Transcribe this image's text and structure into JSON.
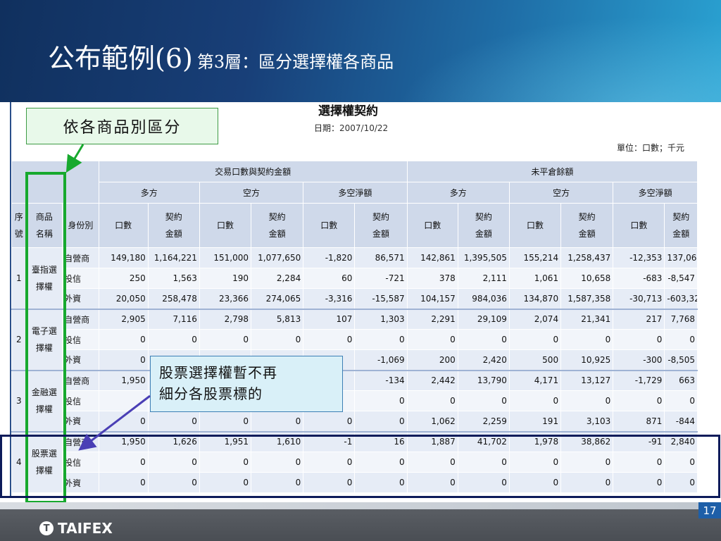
{
  "slide": {
    "title_main": "公布範例(6)",
    "title_sub": "第3層：區分選擇權各商品",
    "page_number": "17"
  },
  "report": {
    "title": "選擇權契約",
    "date_label": "日期：",
    "date_value": "2007/10/22",
    "unit": "單位：口數；千元"
  },
  "table": {
    "header_groups": {
      "traded": "交易口數與契約金額",
      "open_interest": "未平倉餘額"
    },
    "subgroups": {
      "long": "多方",
      "short": "空方",
      "net": "多空淨額"
    },
    "col_seq": [
      "序",
      "號"
    ],
    "col_name": [
      "商品",
      "名稱"
    ],
    "col_identity": "身份別",
    "col_lots": "口數",
    "col_amount": [
      "契約",
      "金額"
    ],
    "groups": [
      {
        "seq": "1",
        "name": [
          "臺指選",
          "擇權"
        ],
        "rows": [
          {
            "identity": "自營商",
            "values": [
              "149,180",
              "1,164,221",
              "151,000",
              "1,077,650",
              "-1,820",
              "86,571",
              "142,861",
              "1,395,505",
              "155,214",
              "1,258,437",
              "-12,353",
              "137,068"
            ]
          },
          {
            "identity": "投信",
            "values": [
              "250",
              "1,563",
              "190",
              "2,284",
              "60",
              "-721",
              "378",
              "2,111",
              "1,061",
              "10,658",
              "-683",
              "-8,547"
            ]
          },
          {
            "identity": "外資",
            "values": [
              "20,050",
              "258,478",
              "23,366",
              "274,065",
              "-3,316",
              "-15,587",
              "104,157",
              "984,036",
              "134,870",
              "1,587,358",
              "-30,713",
              "-603,322"
            ]
          }
        ]
      },
      {
        "seq": "2",
        "name": [
          "電子選",
          "擇權"
        ],
        "rows": [
          {
            "identity": "自營商",
            "values": [
              "2,905",
              "7,116",
              "2,798",
              "5,813",
              "107",
              "1,303",
              "2,291",
              "29,109",
              "2,074",
              "21,341",
              "217",
              "7,768"
            ]
          },
          {
            "identity": "投信",
            "values": [
              "0",
              "0",
              "0",
              "0",
              "0",
              "0",
              "0",
              "0",
              "0",
              "0",
              "0",
              "0"
            ]
          },
          {
            "identity": "外資",
            "values": [
              "0",
              "",
              "",
              "",
              "",
              "-1,069",
              "200",
              "2,420",
              "500",
              "10,925",
              "-300",
              "-8,505"
            ]
          }
        ]
      },
      {
        "seq": "3",
        "name": [
          "金融選",
          "擇權"
        ],
        "rows": [
          {
            "identity": "自營商",
            "values": [
              "1,950",
              "",
              "",
              "",
              "",
              "-134",
              "2,442",
              "13,790",
              "4,171",
              "13,127",
              "-1,729",
              "663"
            ]
          },
          {
            "identity": "投信",
            "values": [
              "",
              "",
              "",
              "",
              "",
              "0",
              "0",
              "0",
              "0",
              "0",
              "0",
              "0"
            ]
          },
          {
            "identity": "外資",
            "values": [
              "0",
              "0",
              "0",
              "0",
              "0",
              "0",
              "1,062",
              "2,259",
              "191",
              "3,103",
              "871",
              "-844"
            ]
          }
        ]
      },
      {
        "seq": "4",
        "name": [
          "股票選",
          "擇權"
        ],
        "rows": [
          {
            "identity": "自營商",
            "values": [
              "1,950",
              "1,626",
              "1,951",
              "1,610",
              "-1",
              "16",
              "1,887",
              "41,702",
              "1,978",
              "38,862",
              "-91",
              "2,840"
            ]
          },
          {
            "identity": "投信",
            "values": [
              "0",
              "0",
              "0",
              "0",
              "0",
              "0",
              "0",
              "0",
              "0",
              "0",
              "0",
              "0"
            ]
          },
          {
            "identity": "外資",
            "values": [
              "0",
              "0",
              "0",
              "0",
              "0",
              "0",
              "0",
              "0",
              "0",
              "0",
              "0",
              "0"
            ]
          }
        ]
      }
    ]
  },
  "callouts": {
    "by_product": "依各商品別區分",
    "stock_options": [
      "股票選擇權暫不再",
      "細分各股票標的"
    ]
  },
  "footer": {
    "logo_text": "TAIFEX",
    "logo_mark": "T"
  },
  "colors": {
    "highlight_green": "#17a92e",
    "highlight_navy": "#0d1b5a",
    "arrow_purple": "#4a3fb5",
    "header_band": "#6f96cf"
  }
}
